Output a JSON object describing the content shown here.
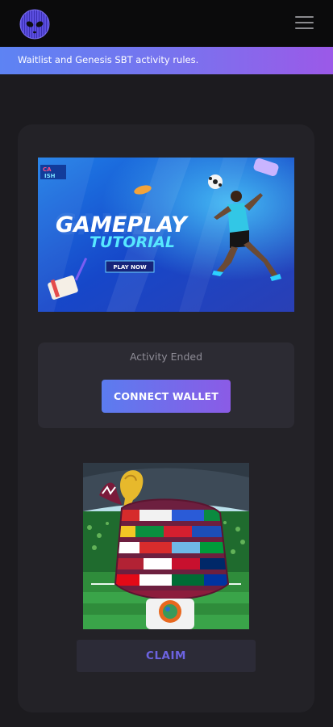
{
  "header": {
    "logo_icon": "alien-logo-icon",
    "menu_icon": "hamburger-menu-icon"
  },
  "banner": {
    "text": "Waitlist and Genesis SBT activity rules."
  },
  "tutorial": {
    "brand_line1": "CA",
    "brand_line2": "ISH",
    "title_line1": "GAMEPLAY",
    "title_line2": "TUTORIAL",
    "play_label": "PLAY NOW"
  },
  "activity": {
    "status": "Activity Ended",
    "connect_label": "CONNECT WALLET"
  },
  "claim": {
    "label": "CLAIM"
  },
  "colors": {
    "page_bg": "#1c1b1f",
    "card_bg": "#232227",
    "accent_start": "#5b7cef",
    "accent_end": "#8b5be6",
    "claim_text": "#6c63e0"
  }
}
